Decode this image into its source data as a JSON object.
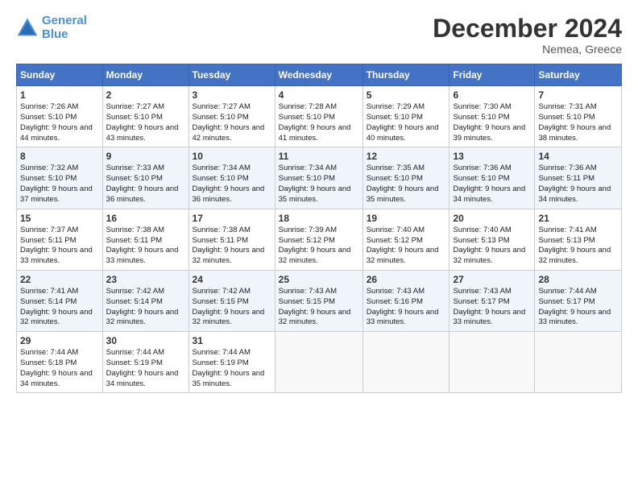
{
  "header": {
    "logo_line1": "General",
    "logo_line2": "Blue",
    "month_title": "December 2024",
    "location": "Nemea, Greece"
  },
  "weekdays": [
    "Sunday",
    "Monday",
    "Tuesday",
    "Wednesday",
    "Thursday",
    "Friday",
    "Saturday"
  ],
  "weeks": [
    [
      {
        "day": "1",
        "info": "Sunrise: 7:26 AM\nSunset: 5:10 PM\nDaylight: 9 hours and 44 minutes."
      },
      {
        "day": "2",
        "info": "Sunrise: 7:27 AM\nSunset: 5:10 PM\nDaylight: 9 hours and 43 minutes."
      },
      {
        "day": "3",
        "info": "Sunrise: 7:27 AM\nSunset: 5:10 PM\nDaylight: 9 hours and 42 minutes."
      },
      {
        "day": "4",
        "info": "Sunrise: 7:28 AM\nSunset: 5:10 PM\nDaylight: 9 hours and 41 minutes."
      },
      {
        "day": "5",
        "info": "Sunrise: 7:29 AM\nSunset: 5:10 PM\nDaylight: 9 hours and 40 minutes."
      },
      {
        "day": "6",
        "info": "Sunrise: 7:30 AM\nSunset: 5:10 PM\nDaylight: 9 hours and 39 minutes."
      },
      {
        "day": "7",
        "info": "Sunrise: 7:31 AM\nSunset: 5:10 PM\nDaylight: 9 hours and 38 minutes."
      }
    ],
    [
      {
        "day": "8",
        "info": "Sunrise: 7:32 AM\nSunset: 5:10 PM\nDaylight: 9 hours and 37 minutes."
      },
      {
        "day": "9",
        "info": "Sunrise: 7:33 AM\nSunset: 5:10 PM\nDaylight: 9 hours and 36 minutes."
      },
      {
        "day": "10",
        "info": "Sunrise: 7:34 AM\nSunset: 5:10 PM\nDaylight: 9 hours and 36 minutes."
      },
      {
        "day": "11",
        "info": "Sunrise: 7:34 AM\nSunset: 5:10 PM\nDaylight: 9 hours and 35 minutes."
      },
      {
        "day": "12",
        "info": "Sunrise: 7:35 AM\nSunset: 5:10 PM\nDaylight: 9 hours and 35 minutes."
      },
      {
        "day": "13",
        "info": "Sunrise: 7:36 AM\nSunset: 5:10 PM\nDaylight: 9 hours and 34 minutes."
      },
      {
        "day": "14",
        "info": "Sunrise: 7:36 AM\nSunset: 5:11 PM\nDaylight: 9 hours and 34 minutes."
      }
    ],
    [
      {
        "day": "15",
        "info": "Sunrise: 7:37 AM\nSunset: 5:11 PM\nDaylight: 9 hours and 33 minutes."
      },
      {
        "day": "16",
        "info": "Sunrise: 7:38 AM\nSunset: 5:11 PM\nDaylight: 9 hours and 33 minutes."
      },
      {
        "day": "17",
        "info": "Sunrise: 7:38 AM\nSunset: 5:11 PM\nDaylight: 9 hours and 32 minutes."
      },
      {
        "day": "18",
        "info": "Sunrise: 7:39 AM\nSunset: 5:12 PM\nDaylight: 9 hours and 32 minutes."
      },
      {
        "day": "19",
        "info": "Sunrise: 7:40 AM\nSunset: 5:12 PM\nDaylight: 9 hours and 32 minutes."
      },
      {
        "day": "20",
        "info": "Sunrise: 7:40 AM\nSunset: 5:13 PM\nDaylight: 9 hours and 32 minutes."
      },
      {
        "day": "21",
        "info": "Sunrise: 7:41 AM\nSunset: 5:13 PM\nDaylight: 9 hours and 32 minutes."
      }
    ],
    [
      {
        "day": "22",
        "info": "Sunrise: 7:41 AM\nSunset: 5:14 PM\nDaylight: 9 hours and 32 minutes."
      },
      {
        "day": "23",
        "info": "Sunrise: 7:42 AM\nSunset: 5:14 PM\nDaylight: 9 hours and 32 minutes."
      },
      {
        "day": "24",
        "info": "Sunrise: 7:42 AM\nSunset: 5:15 PM\nDaylight: 9 hours and 32 minutes."
      },
      {
        "day": "25",
        "info": "Sunrise: 7:43 AM\nSunset: 5:15 PM\nDaylight: 9 hours and 32 minutes."
      },
      {
        "day": "26",
        "info": "Sunrise: 7:43 AM\nSunset: 5:16 PM\nDaylight: 9 hours and 33 minutes."
      },
      {
        "day": "27",
        "info": "Sunrise: 7:43 AM\nSunset: 5:17 PM\nDaylight: 9 hours and 33 minutes."
      },
      {
        "day": "28",
        "info": "Sunrise: 7:44 AM\nSunset: 5:17 PM\nDaylight: 9 hours and 33 minutes."
      }
    ],
    [
      {
        "day": "29",
        "info": "Sunrise: 7:44 AM\nSunset: 5:18 PM\nDaylight: 9 hours and 34 minutes."
      },
      {
        "day": "30",
        "info": "Sunrise: 7:44 AM\nSunset: 5:19 PM\nDaylight: 9 hours and 34 minutes."
      },
      {
        "day": "31",
        "info": "Sunrise: 7:44 AM\nSunset: 5:19 PM\nDaylight: 9 hours and 35 minutes."
      },
      null,
      null,
      null,
      null
    ]
  ]
}
